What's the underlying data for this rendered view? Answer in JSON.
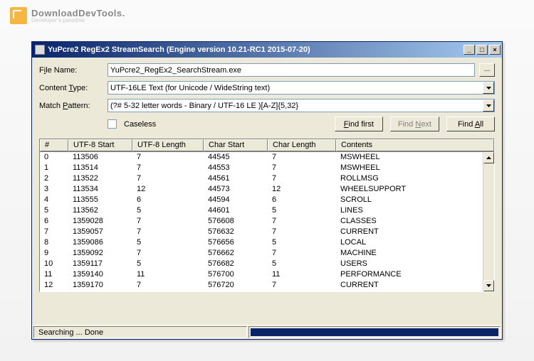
{
  "brand": {
    "name": "DownloadDevTools.",
    "tagline": "Developer's paradise"
  },
  "window": {
    "title": "YuPcre2 RegEx2 StreamSearch (Engine version 10.21-RC1 2015-07-20)"
  },
  "form": {
    "fileNameLabel": "File Name:",
    "fileNameValue": "YuPcre2_RegEx2_SearchStream.exe",
    "contentTypeLabel": "Content Type:",
    "contentTypeValue": "UTF-16LE Text (for Unicode / WideString text)",
    "matchPatternLabel": "Match Pattern:",
    "matchPatternValue": "(?# 5-32 letter words - Binary / UTF-16 LE )[A-Z]{5,32}",
    "caselessLabel": "Caseless",
    "browseLabel": "...",
    "findFirst": "Find first",
    "findNext": "Find Next",
    "findAll": "Find All"
  },
  "grid": {
    "headers": [
      "#",
      "UTF-8 Start",
      "UTF-8 Length",
      "Char Start",
      "Char Length",
      "Contents"
    ],
    "rows": [
      {
        "i": "0",
        "s": "113506",
        "l": "7",
        "cs": "44545",
        "cl": "7",
        "c": "MSWHEEL"
      },
      {
        "i": "1",
        "s": "113514",
        "l": "7",
        "cs": "44553",
        "cl": "7",
        "c": "MSWHEEL"
      },
      {
        "i": "2",
        "s": "113522",
        "l": "7",
        "cs": "44561",
        "cl": "7",
        "c": "ROLLMSG"
      },
      {
        "i": "3",
        "s": "113534",
        "l": "12",
        "cs": "44573",
        "cl": "12",
        "c": "WHEELSUPPORT"
      },
      {
        "i": "4",
        "s": "113555",
        "l": "6",
        "cs": "44594",
        "cl": "6",
        "c": "SCROLL"
      },
      {
        "i": "5",
        "s": "113562",
        "l": "5",
        "cs": "44601",
        "cl": "5",
        "c": "LINES"
      },
      {
        "i": "6",
        "s": "1359028",
        "l": "7",
        "cs": "576608",
        "cl": "7",
        "c": "CLASSES"
      },
      {
        "i": "7",
        "s": "1359057",
        "l": "7",
        "cs": "576632",
        "cl": "7",
        "c": "CURRENT"
      },
      {
        "i": "8",
        "s": "1359086",
        "l": "5",
        "cs": "576656",
        "cl": "5",
        "c": "LOCAL"
      },
      {
        "i": "9",
        "s": "1359092",
        "l": "7",
        "cs": "576662",
        "cl": "7",
        "c": "MACHINE"
      },
      {
        "i": "10",
        "s": "1359117",
        "l": "5",
        "cs": "576682",
        "cl": "5",
        "c": "USERS"
      },
      {
        "i": "11",
        "s": "1359140",
        "l": "11",
        "cs": "576700",
        "cl": "11",
        "c": "PERFORMANCE"
      },
      {
        "i": "12",
        "s": "1359170",
        "l": "7",
        "cs": "576720",
        "cl": "7",
        "c": "CURRENT"
      }
    ]
  },
  "status": {
    "message": "Searching ... Done"
  }
}
